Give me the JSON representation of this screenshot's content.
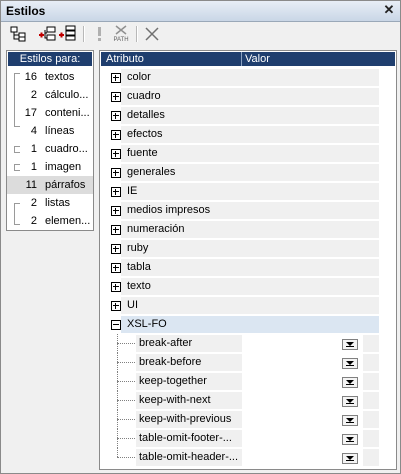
{
  "window": {
    "title": "Estilos"
  },
  "toolbar": {
    "buttons": [
      {
        "icon": "tree-view-icon"
      },
      {
        "icon": "add-selector-icon"
      },
      {
        "icon": "add-rule-icon"
      },
      {
        "icon": "important-icon"
      },
      {
        "icon": "xpath-icon",
        "label": "PATH"
      },
      {
        "icon": "delete-icon"
      }
    ]
  },
  "styles_for": {
    "header": "Estilos para:",
    "items": [
      {
        "count": "16",
        "label": "textos"
      },
      {
        "count": "2",
        "label": "cálculo..."
      },
      {
        "count": "17",
        "label": "conteni..."
      },
      {
        "count": "4",
        "label": "líneas"
      },
      {
        "count": "1",
        "label": "cuadro..."
      },
      {
        "count": "1",
        "label": "imagen"
      },
      {
        "count": "11",
        "label": "párrafos"
      },
      {
        "count": "2",
        "label": "listas"
      },
      {
        "count": "2",
        "label": "elemen..."
      }
    ]
  },
  "grid": {
    "col_attribute": "Atributo",
    "col_value": "Valor",
    "groups": [
      "color",
      "cuadro",
      "detalles",
      "efectos",
      "fuente",
      "generales",
      "IE",
      "medios impresos",
      "numeración",
      "ruby",
      "tabla",
      "texto",
      "UI"
    ],
    "expanded_group": "XSL-FO",
    "children": [
      "break-after",
      "break-before",
      "keep-together",
      "keep-with-next",
      "keep-with-previous",
      "table-omit-footer-...",
      "table-omit-header-..."
    ]
  }
}
